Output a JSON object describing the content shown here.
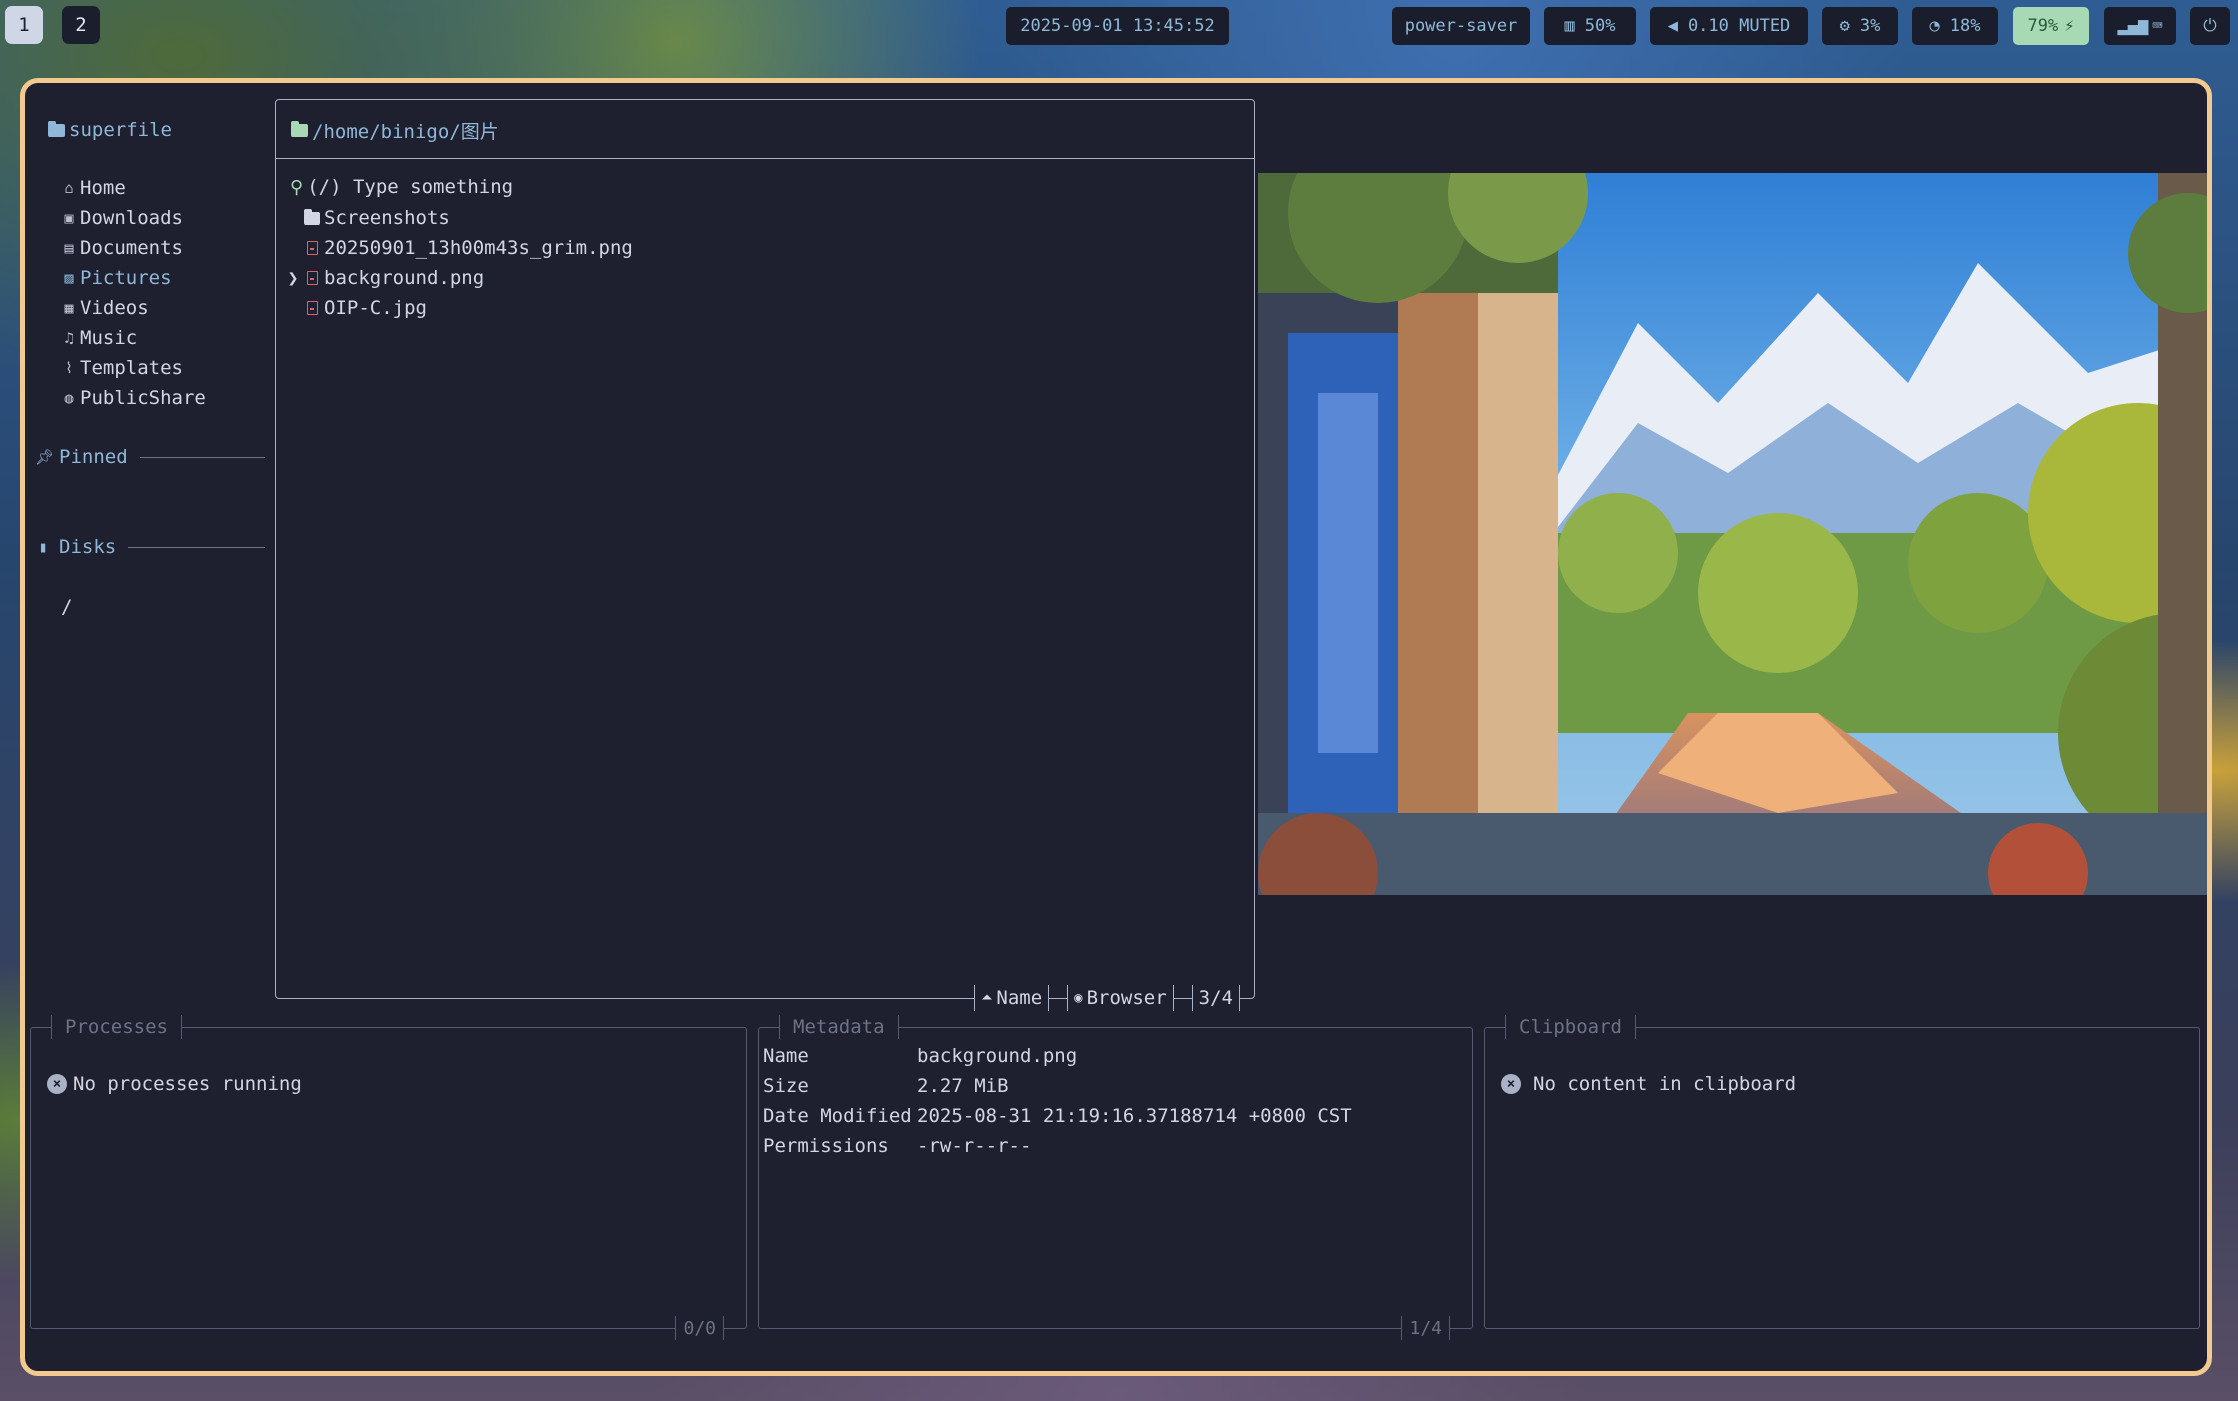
{
  "topbar": {
    "workspaces": [
      "1",
      "2"
    ],
    "clock": "2025-09-01 13:45:52",
    "power_profile": "power-saver",
    "memory": "50%",
    "volume": "0.10 MUTED",
    "cpu": "3%",
    "disk": "18%",
    "battery": "79%"
  },
  "sidebar": {
    "title": "superfile",
    "items": [
      {
        "label": "Home",
        "icon": "home-icon"
      },
      {
        "label": "Downloads",
        "icon": "download-icon"
      },
      {
        "label": "Documents",
        "icon": "document-icon"
      },
      {
        "label": "Pictures",
        "icon": "picture-icon"
      },
      {
        "label": "Videos",
        "icon": "video-icon"
      },
      {
        "label": "Music",
        "icon": "music-icon"
      },
      {
        "label": "Templates",
        "icon": "paperclip-icon"
      },
      {
        "label": "PublicShare",
        "icon": "globe-icon"
      }
    ],
    "pinned_label": "Pinned",
    "disks_label": "Disks",
    "disks": [
      "/"
    ]
  },
  "filepanel": {
    "path": "/home/binigo/图片",
    "search_placeholder": "(/) Type something",
    "files": [
      {
        "name": "Screenshots",
        "type": "folder"
      },
      {
        "name": "20250901_13h00m43s_grim.png",
        "type": "file"
      },
      {
        "name": "background.png",
        "type": "file",
        "selected": true
      },
      {
        "name": "OIP-C.jpg",
        "type": "file"
      }
    ],
    "footer": {
      "sort": "Name",
      "mode": "Browser",
      "position": "3/4"
    }
  },
  "processes": {
    "title": "Processes",
    "empty": "No processes running",
    "count": "0/0"
  },
  "metadata": {
    "title": "Metadata",
    "rows": [
      {
        "key": "Name",
        "value": "background.png"
      },
      {
        "key": "Size",
        "value": "2.27 MiB"
      },
      {
        "key": "Date Modified",
        "value": "2025-08-31 21:19:16.37188714 +0800 CST"
      },
      {
        "key": "Permissions",
        "value": "-rw-r--r--"
      }
    ],
    "count": "1/4"
  },
  "clipboard": {
    "title": "Clipboard",
    "empty": "No content in clipboard"
  },
  "colors": {
    "accent": "#8fb8d8",
    "border": "#f2c98e",
    "file_icon": "#e26565",
    "green": "#a7d9b4"
  }
}
